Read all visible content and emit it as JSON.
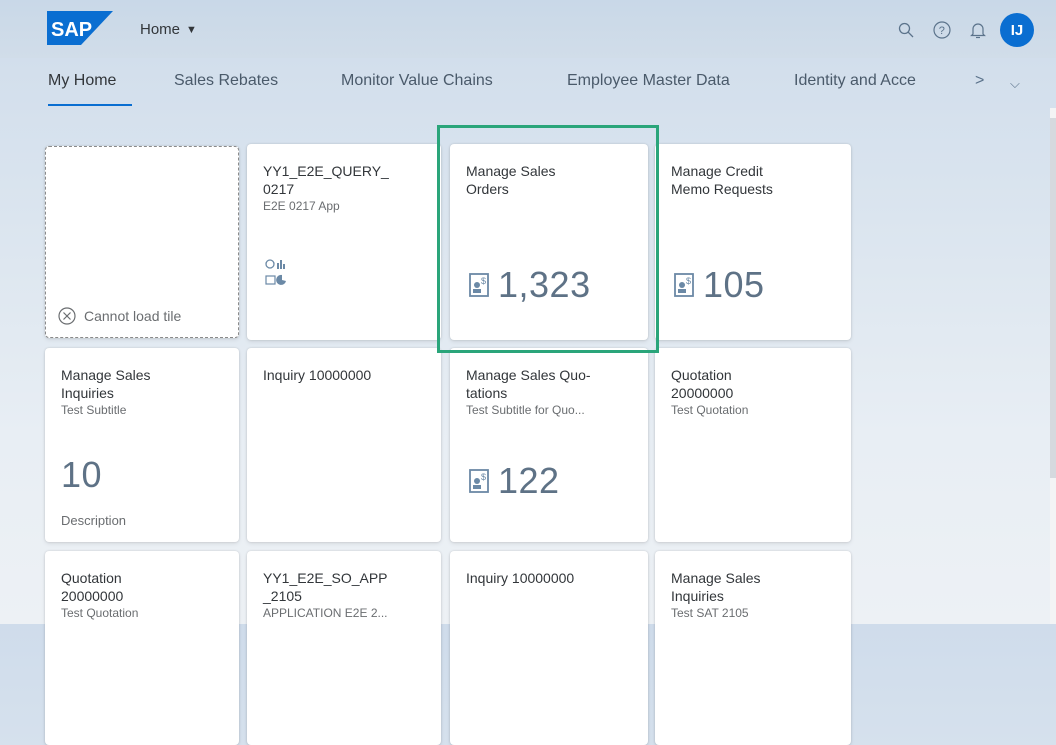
{
  "shell": {
    "logo_text": "SAP",
    "home_label": "Home",
    "avatar_initials": "IJ",
    "icons": [
      "search-icon",
      "help-icon",
      "notifications-icon"
    ]
  },
  "tabs": [
    {
      "label": "My Home",
      "active": true
    },
    {
      "label": "Sales Rebates",
      "active": false
    },
    {
      "label": "Monitor Value Chains",
      "active": false
    },
    {
      "label": "Employee Master Data",
      "active": false
    },
    {
      "label": "Identity and Acce",
      "active": false
    }
  ],
  "tab_overflow": {
    "more": ">",
    "menu": "⌵"
  },
  "tiles": {
    "t1": {
      "error": "Cannot load tile"
    },
    "t2": {
      "title_line1": "YY1_E2E_QUERY_",
      "title_line2": "0217",
      "subtitle": "E2E 0217 App"
    },
    "t3": {
      "title_line1": "Manage Sales",
      "title_line2": "Orders",
      "kpi": "1,323"
    },
    "t4": {
      "title_line1": "Manage Credit",
      "title_line2": "Memo Requests",
      "kpi": "105"
    },
    "t5": {
      "title_line1": "Manage Sales",
      "title_line2": "Inquiries",
      "subtitle": "Test Subtitle",
      "kpi": "10",
      "footer": "Description"
    },
    "t6": {
      "title_line1": "Inquiry 10000000"
    },
    "t7": {
      "title_line1": "Manage Sales Quo-",
      "title_line2": "tations",
      "subtitle": "Test Subtitle for Quo...",
      "kpi": "122"
    },
    "t8": {
      "title_line1": "Quotation",
      "title_line2": "20000000",
      "subtitle": "Test Quotation"
    },
    "t9": {
      "title_line1": "Quotation",
      "title_line2": "20000000",
      "subtitle": "Test Quotation"
    },
    "t10": {
      "title_line1": "YY1_E2E_SO_APP",
      "title_line2": "_2105",
      "subtitle": "APPLICATION E2E 2..."
    },
    "t11": {
      "title_line1": "Inquiry 10000000"
    },
    "t12": {
      "title_line1": "Manage Sales",
      "title_line2": "Inquiries",
      "subtitle": "Test SAT 2105"
    }
  },
  "colors": {
    "accent": "#0a6ed1",
    "highlight": "#2aa57a",
    "logo": "#0a6ed1"
  }
}
